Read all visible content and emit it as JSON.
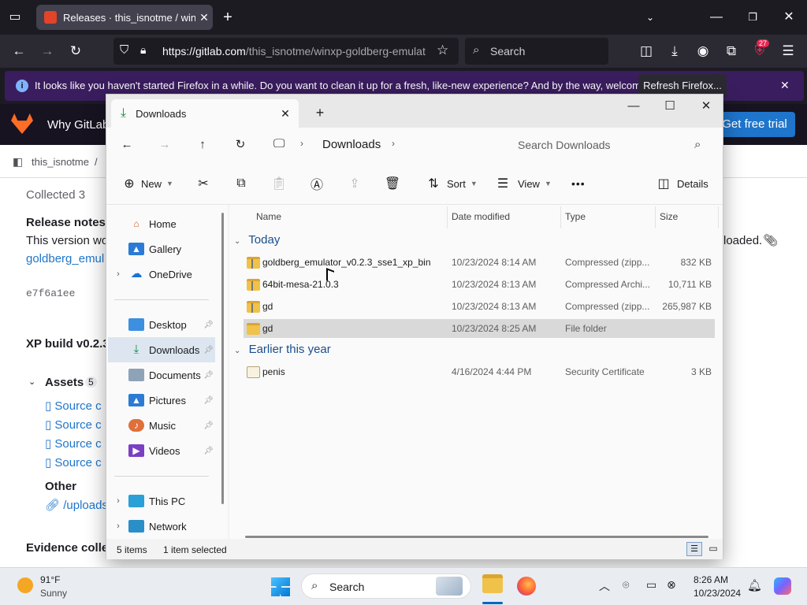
{
  "browser": {
    "tab_title": "Releases · this_isnotme / winxp",
    "url_host": "https://gitlab.com",
    "url_path": "/this_isnotme/winxp-goldberg-emulat",
    "search_placeholder": "Search",
    "extension_badge": "27"
  },
  "notification": {
    "message": "It looks like you haven't started Firefox in a while. Do you want to clean it up for a fresh, like-new experience? And by the way, welcome back!",
    "button": "Refresh Firefox..."
  },
  "gitlab": {
    "nav_item": "Why GitLab",
    "trial_button": "Get free trial",
    "breadcrumb_user": "this_isnotme",
    "breadcrumb_sep": "/",
    "collected": "Collected 3",
    "release_notes": "Release notes",
    "version_text": "This version wo",
    "right_text": "loaded.",
    "link1": "goldberg_emul",
    "commit": "e7f6a1ee",
    "build_title": "XP build v0.2.3",
    "assets_label": "Assets",
    "assets_count": "5",
    "source_items": [
      "Source c",
      "Source c",
      "Source c",
      "Source c"
    ],
    "other_label": "Other",
    "uploads_link": "/uploads",
    "evidence": "Evidence colle"
  },
  "explorer": {
    "tab_title": "Downloads",
    "path_current": "Downloads",
    "search_placeholder": "Search Downloads",
    "toolbar": {
      "new": "New",
      "sort": "Sort",
      "view": "View",
      "more": "•••",
      "details": "Details"
    },
    "nav": [
      {
        "label": "Home",
        "icon": "home-icon",
        "pinned": false,
        "expandable": false
      },
      {
        "label": "Gallery",
        "icon": "gallery-icon",
        "pinned": false,
        "expandable": false
      },
      {
        "label": "OneDrive",
        "icon": "cloud-icon",
        "pinned": false,
        "expandable": true
      },
      {
        "label": "Desktop",
        "icon": "desktop-icon",
        "pinned": true,
        "expandable": false
      },
      {
        "label": "Downloads",
        "icon": "download-icon",
        "pinned": true,
        "expandable": false,
        "selected": true
      },
      {
        "label": "Documents",
        "icon": "documents-icon",
        "pinned": true,
        "expandable": false
      },
      {
        "label": "Pictures",
        "icon": "pictures-icon",
        "pinned": true,
        "expandable": false
      },
      {
        "label": "Music",
        "icon": "music-icon",
        "pinned": true,
        "expandable": false
      },
      {
        "label": "Videos",
        "icon": "videos-icon",
        "pinned": true,
        "expandable": false
      },
      {
        "label": "This PC",
        "icon": "pc-icon",
        "pinned": false,
        "expandable": true
      },
      {
        "label": "Network",
        "icon": "network-icon",
        "pinned": false,
        "expandable": true
      }
    ],
    "columns": {
      "name": "Name",
      "date": "Date modified",
      "type": "Type",
      "size": "Size"
    },
    "groups": [
      {
        "label": "Today",
        "rows": [
          {
            "name": "goldberg_emulator_v0.2.3_sse1_xp_bin",
            "date": "10/23/2024 8:14 AM",
            "type": "Compressed (zipp...",
            "size": "832 KB",
            "icon": "zip-folder-icon"
          },
          {
            "name": "64bit-mesa-21.0.3",
            "date": "10/23/2024 8:13 AM",
            "type": "Compressed Archi...",
            "size": "10,711 KB",
            "icon": "zip-folder-icon"
          },
          {
            "name": "gd",
            "date": "10/23/2024 8:13 AM",
            "type": "Compressed (zipp...",
            "size": "265,987 KB",
            "icon": "zip-folder-icon"
          },
          {
            "name": "gd",
            "date": "10/23/2024 8:25 AM",
            "type": "File folder",
            "size": "",
            "icon": "folder-icon",
            "selected": true
          }
        ]
      },
      {
        "label": "Earlier this year",
        "rows": [
          {
            "name": "penis",
            "date": "4/16/2024 4:44 PM",
            "type": "Security Certificate",
            "size": "3 KB",
            "icon": "certificate-icon"
          }
        ]
      }
    ],
    "status": {
      "items": "5 items",
      "selected": "1 item selected"
    }
  },
  "taskbar": {
    "temp": "91°F",
    "weather": "Sunny",
    "search": "Search",
    "time": "8:26 AM",
    "date": "10/23/2024"
  }
}
